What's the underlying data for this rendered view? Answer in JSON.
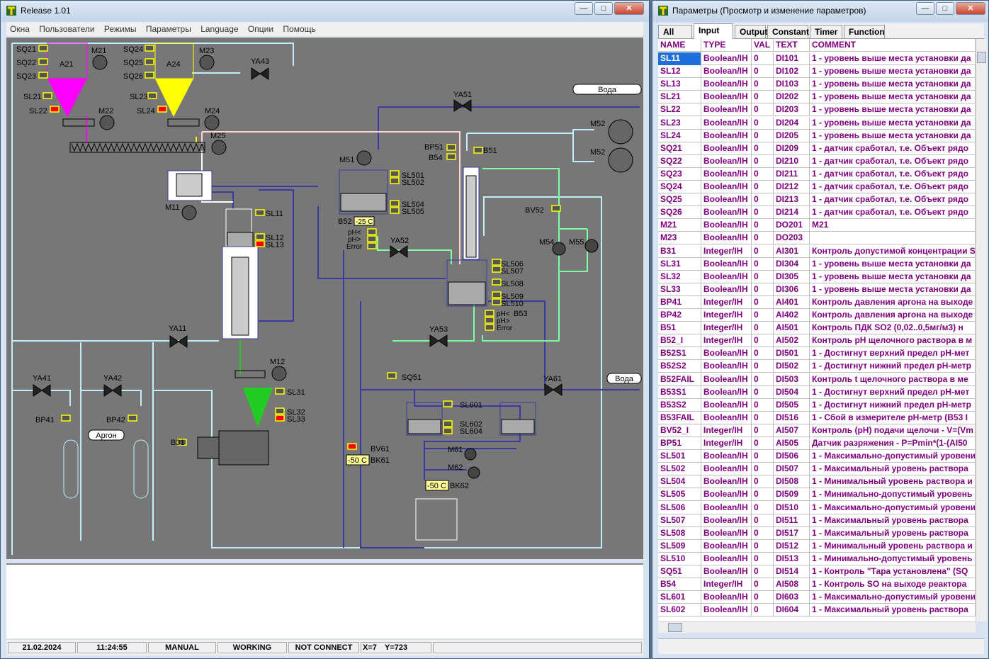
{
  "main_window": {
    "title": "Release 1.01",
    "min": "—",
    "max": "□",
    "close": "✕"
  },
  "menu": [
    "Окна",
    "Пользователи",
    "Режимы",
    "Параметры",
    "Language",
    "Опции",
    "Помощь"
  ],
  "diagram": {
    "labels": [
      "SQ21",
      "SQ22",
      "SQ23",
      "M21",
      "A21",
      "SQ24",
      "SQ25",
      "SQ26",
      "A24",
      "M23",
      "YA43",
      "SL21",
      "SL22",
      "M22",
      "SL23",
      "SL24",
      "M24",
      "M25",
      "M11",
      "SL11",
      "SL12",
      "SL13",
      "M51",
      "SL501",
      "SL502",
      "SL504",
      "SL505",
      "B52",
      "pH<",
      "pH>",
      "Error",
      "YA52",
      "YA51",
      "BP51",
      "B54",
      "B51",
      "M52",
      "M52",
      "BV52",
      "M54",
      "M55",
      "SL506",
      "SL507",
      "SL508",
      "SL509",
      "SL510",
      "B53",
      "pH<",
      "pH>",
      "Error",
      "YA53",
      "YA11",
      "YA41",
      "YA42",
      "BP41",
      "BP42",
      "Аргон",
      "M12",
      "SL31",
      "SL32",
      "SL33",
      "B31",
      "SQ51",
      "YA61",
      "SL601",
      "SL602",
      "SL604",
      "M61",
      "M62",
      "BV61",
      "BK61",
      "BK62"
    ],
    "water1": "Вода",
    "water2": "Вода",
    "b52_val": "-25 C",
    "bk61_val": "-50 C",
    "bk62_val": "-50 C"
  },
  "statusbar": {
    "date": "21.02.2024",
    "time": "11:24:55",
    "mode": "MANUAL",
    "state": "WORKING",
    "conn": "NOT CONNECT",
    "x": "X=7",
    "y": "Y=723"
  },
  "params_window": {
    "title": "Параметры (Просмотр и изменение параметров)",
    "min": "—",
    "max": "□",
    "close": "✕"
  },
  "tabs": [
    "All",
    "Input",
    "Output",
    "Constant",
    "Timer",
    "Function"
  ],
  "active_tab": "Input",
  "columns": [
    "NAME",
    "TYPE",
    "VAL",
    "TEXT",
    "COMMENT"
  ],
  "rows": [
    [
      "SL11",
      "Boolean/IH",
      "0",
      "DI101",
      "1 - уровень выше места установки да"
    ],
    [
      "SL12",
      "Boolean/IH",
      "0",
      "DI102",
      "1 - уровень выше места установки да"
    ],
    [
      "SL13",
      "Boolean/IH",
      "0",
      "DI103",
      "1 - уровень выше места установки да"
    ],
    [
      "SL21",
      "Boolean/IH",
      "0",
      "DI202",
      "1 - уровень выше места установки да"
    ],
    [
      "SL22",
      "Boolean/IH",
      "0",
      "DI203",
      "1 - уровень выше места установки да"
    ],
    [
      "SL23",
      "Boolean/IH",
      "0",
      "DI204",
      "1 - уровень выше места установки да"
    ],
    [
      "SL24",
      "Boolean/IH",
      "0",
      "DI205",
      "1 - уровень выше места установки да"
    ],
    [
      "SQ21",
      "Boolean/IH",
      "0",
      "DI209",
      "1 - датчик сработал, т.е. Объект рядо"
    ],
    [
      "SQ22",
      "Boolean/IH",
      "0",
      "DI210",
      "1 - датчик сработал, т.е. Объект рядо"
    ],
    [
      "SQ23",
      "Boolean/IH",
      "0",
      "DI211",
      "1 - датчик сработал, т.е. Объект рядо"
    ],
    [
      "SQ24",
      "Boolean/IH",
      "0",
      "DI212",
      "1 - датчик сработал, т.е. Объект рядо"
    ],
    [
      "SQ25",
      "Boolean/IH",
      "0",
      "DI213",
      "1 - датчик сработал, т.е. Объект рядо"
    ],
    [
      "SQ26",
      "Boolean/IH",
      "0",
      "DI214",
      "1 - датчик сработал, т.е. Объект рядо"
    ],
    [
      "M21",
      "Boolean/IH",
      "0",
      "DO201",
      "M21"
    ],
    [
      "M23",
      "Boolean/IH",
      "0",
      "DO203",
      ""
    ],
    [
      "B31",
      "Integer/IH",
      "0",
      "AI301",
      "Контроль допустимой концентрации S"
    ],
    [
      "SL31",
      "Boolean/IH",
      "0",
      "DI304",
      "1 - уровень выше места установки да"
    ],
    [
      "SL32",
      "Boolean/IH",
      "0",
      "DI305",
      "1 - уровень выше места установки да"
    ],
    [
      "SL33",
      "Boolean/IH",
      "0",
      "DI306",
      "1 - уровень выше места установки да"
    ],
    [
      "BP41",
      "Integer/IH",
      "0",
      "AI401",
      "Контроль давления аргона на выходе"
    ],
    [
      "BP42",
      "Integer/IH",
      "0",
      "AI402",
      "Контроль давления аргона на выходе"
    ],
    [
      "B51",
      "Integer/IH",
      "0",
      "AI501",
      "Контроль ПДК SO2 (0,02..0,5мг/м3) н"
    ],
    [
      "B52_I",
      "Integer/IH",
      "0",
      "AI502",
      "Контроль pH щелочного раствора в м"
    ],
    [
      "B52S1",
      "Boolean/IH",
      "0",
      "DI501",
      "1 - Достигнут верхний предел pH-мет"
    ],
    [
      "B52S2",
      "Boolean/IH",
      "0",
      "DI502",
      "1 - Достигнут нижний предел pH-метр"
    ],
    [
      "B52FAIL",
      "Boolean/IH",
      "0",
      "DI503",
      "Контроль t щелочного раствора в ме"
    ],
    [
      "B53S1",
      "Boolean/IH",
      "0",
      "DI504",
      "1 - Достигнут верхний предел pH-мет"
    ],
    [
      "B53S2",
      "Boolean/IH",
      "0",
      "DI505",
      "1 - Достигнут нижний предел pH-метр"
    ],
    [
      "B53FAIL",
      "Boolean/IH",
      "0",
      "DI516",
      "1 - Сбой в измерителе pH-метр (B53 I"
    ],
    [
      "BV52_I",
      "Integer/IH",
      "0",
      "AI507",
      "Контроль (pH) подачи щелочи - V=(Vm"
    ],
    [
      "BP51",
      "Integer/IH",
      "0",
      "AI505",
      "Датчик разряжения - P=Pmin*(1-(AI50"
    ],
    [
      "SL501",
      "Boolean/IH",
      "0",
      "DI506",
      "1 - Максимально-допустимый уровени"
    ],
    [
      "SL502",
      "Boolean/IH",
      "0",
      "DI507",
      "1 - Максимальный уровень раствора"
    ],
    [
      "SL504",
      "Boolean/IH",
      "0",
      "DI508",
      "1 - Минимальный уровень раствора и"
    ],
    [
      "SL505",
      "Boolean/IH",
      "0",
      "DI509",
      "1 - Минимально-допустимый уровень"
    ],
    [
      "SL506",
      "Boolean/IH",
      "0",
      "DI510",
      "1 - Максимально-допустимый уровени"
    ],
    [
      "SL507",
      "Boolean/IH",
      "0",
      "DI511",
      "1 - Максимальный уровень раствора"
    ],
    [
      "SL508",
      "Boolean/IH",
      "0",
      "DI517",
      "1 - Максимальный уровень раствора"
    ],
    [
      "SL509",
      "Boolean/IH",
      "0",
      "DI512",
      "1 - Минимальный уровень раствора и"
    ],
    [
      "SL510",
      "Boolean/IH",
      "0",
      "DI513",
      "1 - Минимально-допустимый уровень"
    ],
    [
      "SQ51",
      "Boolean/IH",
      "0",
      "DI514",
      "1 - Контроль \"Тара установлена\" (SQ"
    ],
    [
      "B54",
      "Integer/IH",
      "0",
      "AI508",
      "1 - Контроль SO на выходе реактора"
    ],
    [
      "SL601",
      "Boolean/IH",
      "0",
      "DI603",
      "1 - Максимально-допустимый уровени"
    ],
    [
      "SL602",
      "Boolean/IH",
      "0",
      "DI604",
      "1 - Максимальный уровень раствора"
    ]
  ]
}
